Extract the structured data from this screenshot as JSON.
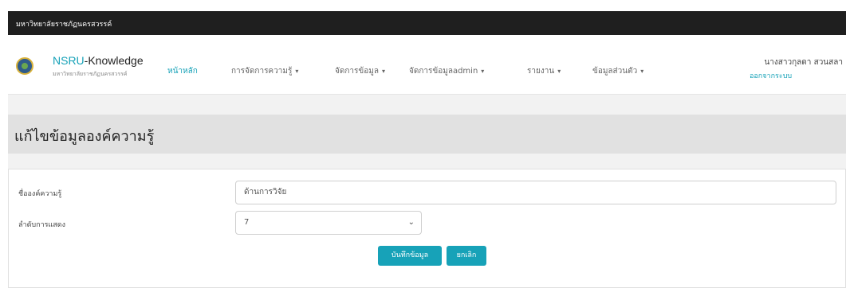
{
  "topbar": {
    "university": "มหาวิทยาลัยราชภัฏนครสวรรค์"
  },
  "brand": {
    "prefix": "NSRU",
    "suffix": "-Knowledge",
    "subtitle": "มหาวิทยาลัยราชภัฏนครสวรรค์"
  },
  "nav": {
    "items": [
      {
        "label": "หน้าหลัก",
        "caret": ""
      },
      {
        "label": "การจัดการความรู้",
        "caret": "▾"
      },
      {
        "label": "จัดการข้อมูล",
        "caret": "▾"
      },
      {
        "label": "จัดการข้อมูลadmin",
        "caret": "▾"
      },
      {
        "label": "รายงาน",
        "caret": "▾"
      },
      {
        "label": "ข้อมูลส่วนตัว",
        "caret": "▾"
      }
    ]
  },
  "user": {
    "name": "นางสาวกุลดา สวนสลา",
    "logout_label": "ออกจากระบบ"
  },
  "page": {
    "title": "แก้ไขข้อมูลองค์ความรู้"
  },
  "form": {
    "name_label": "ชื่อองค์ความรู้",
    "name_value": "ด้านการวิจัย",
    "order_label": "ลำดับการแสดง",
    "order_value": "7",
    "save_label": "บันทึกข้อมูล",
    "cancel_label": "ยกเลิก"
  },
  "colors": {
    "accent": "#17a2b8",
    "topbar": "#1f1f1f",
    "header_band": "#e1e1e1"
  }
}
